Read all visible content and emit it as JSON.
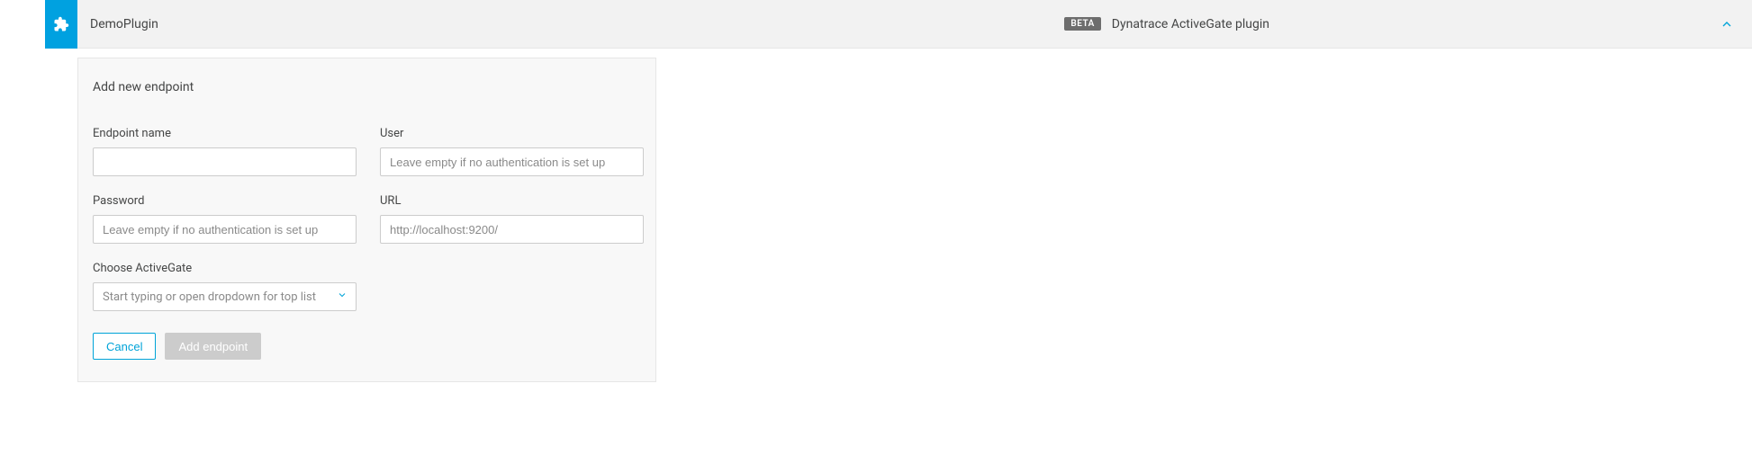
{
  "header": {
    "plugin_name": "DemoPlugin",
    "beta_badge": "BETA",
    "plugin_type": "Dynatrace ActiveGate plugin"
  },
  "form": {
    "title": "Add new endpoint",
    "fields": {
      "endpoint_name": {
        "label": "Endpoint name",
        "value": "",
        "placeholder": ""
      },
      "user": {
        "label": "User",
        "value": "",
        "placeholder": "Leave empty if no authentication is set up"
      },
      "password": {
        "label": "Password",
        "value": "",
        "placeholder": "Leave empty if no authentication is set up"
      },
      "url": {
        "label": "URL",
        "value": "",
        "placeholder": "http://localhost:9200/"
      },
      "choose_activegate": {
        "label": "Choose ActiveGate",
        "placeholder": "Start typing or open dropdown for top list"
      }
    },
    "actions": {
      "cancel": "Cancel",
      "add_endpoint": "Add endpoint"
    }
  }
}
